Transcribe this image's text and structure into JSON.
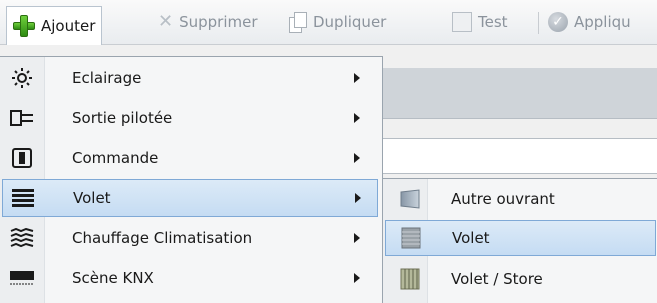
{
  "toolbar": {
    "add_label": "Ajouter",
    "delete_label": "Supprimer",
    "duplicate_label": "Dupliquer",
    "test_label": "Test",
    "apply_label": "Appliqu"
  },
  "menu": {
    "items": [
      {
        "label": "Eclairage",
        "icon": "light-bulb-icon"
      },
      {
        "label": "Sortie pilotée",
        "icon": "plug-icon"
      },
      {
        "label": "Commande",
        "icon": "switch-icon"
      },
      {
        "label": "Volet",
        "icon": "shutter-icon"
      },
      {
        "label": "Chauffage Climatisation",
        "icon": "heating-icon"
      },
      {
        "label": "Scène KNX",
        "icon": "scene-icon"
      }
    ],
    "selected_index": 3
  },
  "submenu": {
    "items": [
      {
        "label": "Autre ouvrant",
        "icon": "door-icon"
      },
      {
        "label": "Volet",
        "icon": "roller-shutter-icon"
      },
      {
        "label": "Volet / Store",
        "icon": "blind-icon"
      }
    ],
    "selected_index": 1
  },
  "colors": {
    "selection_fill": "#c5dcf3",
    "selection_border": "#7fa9d6",
    "add_icon": "#3fa21c"
  }
}
